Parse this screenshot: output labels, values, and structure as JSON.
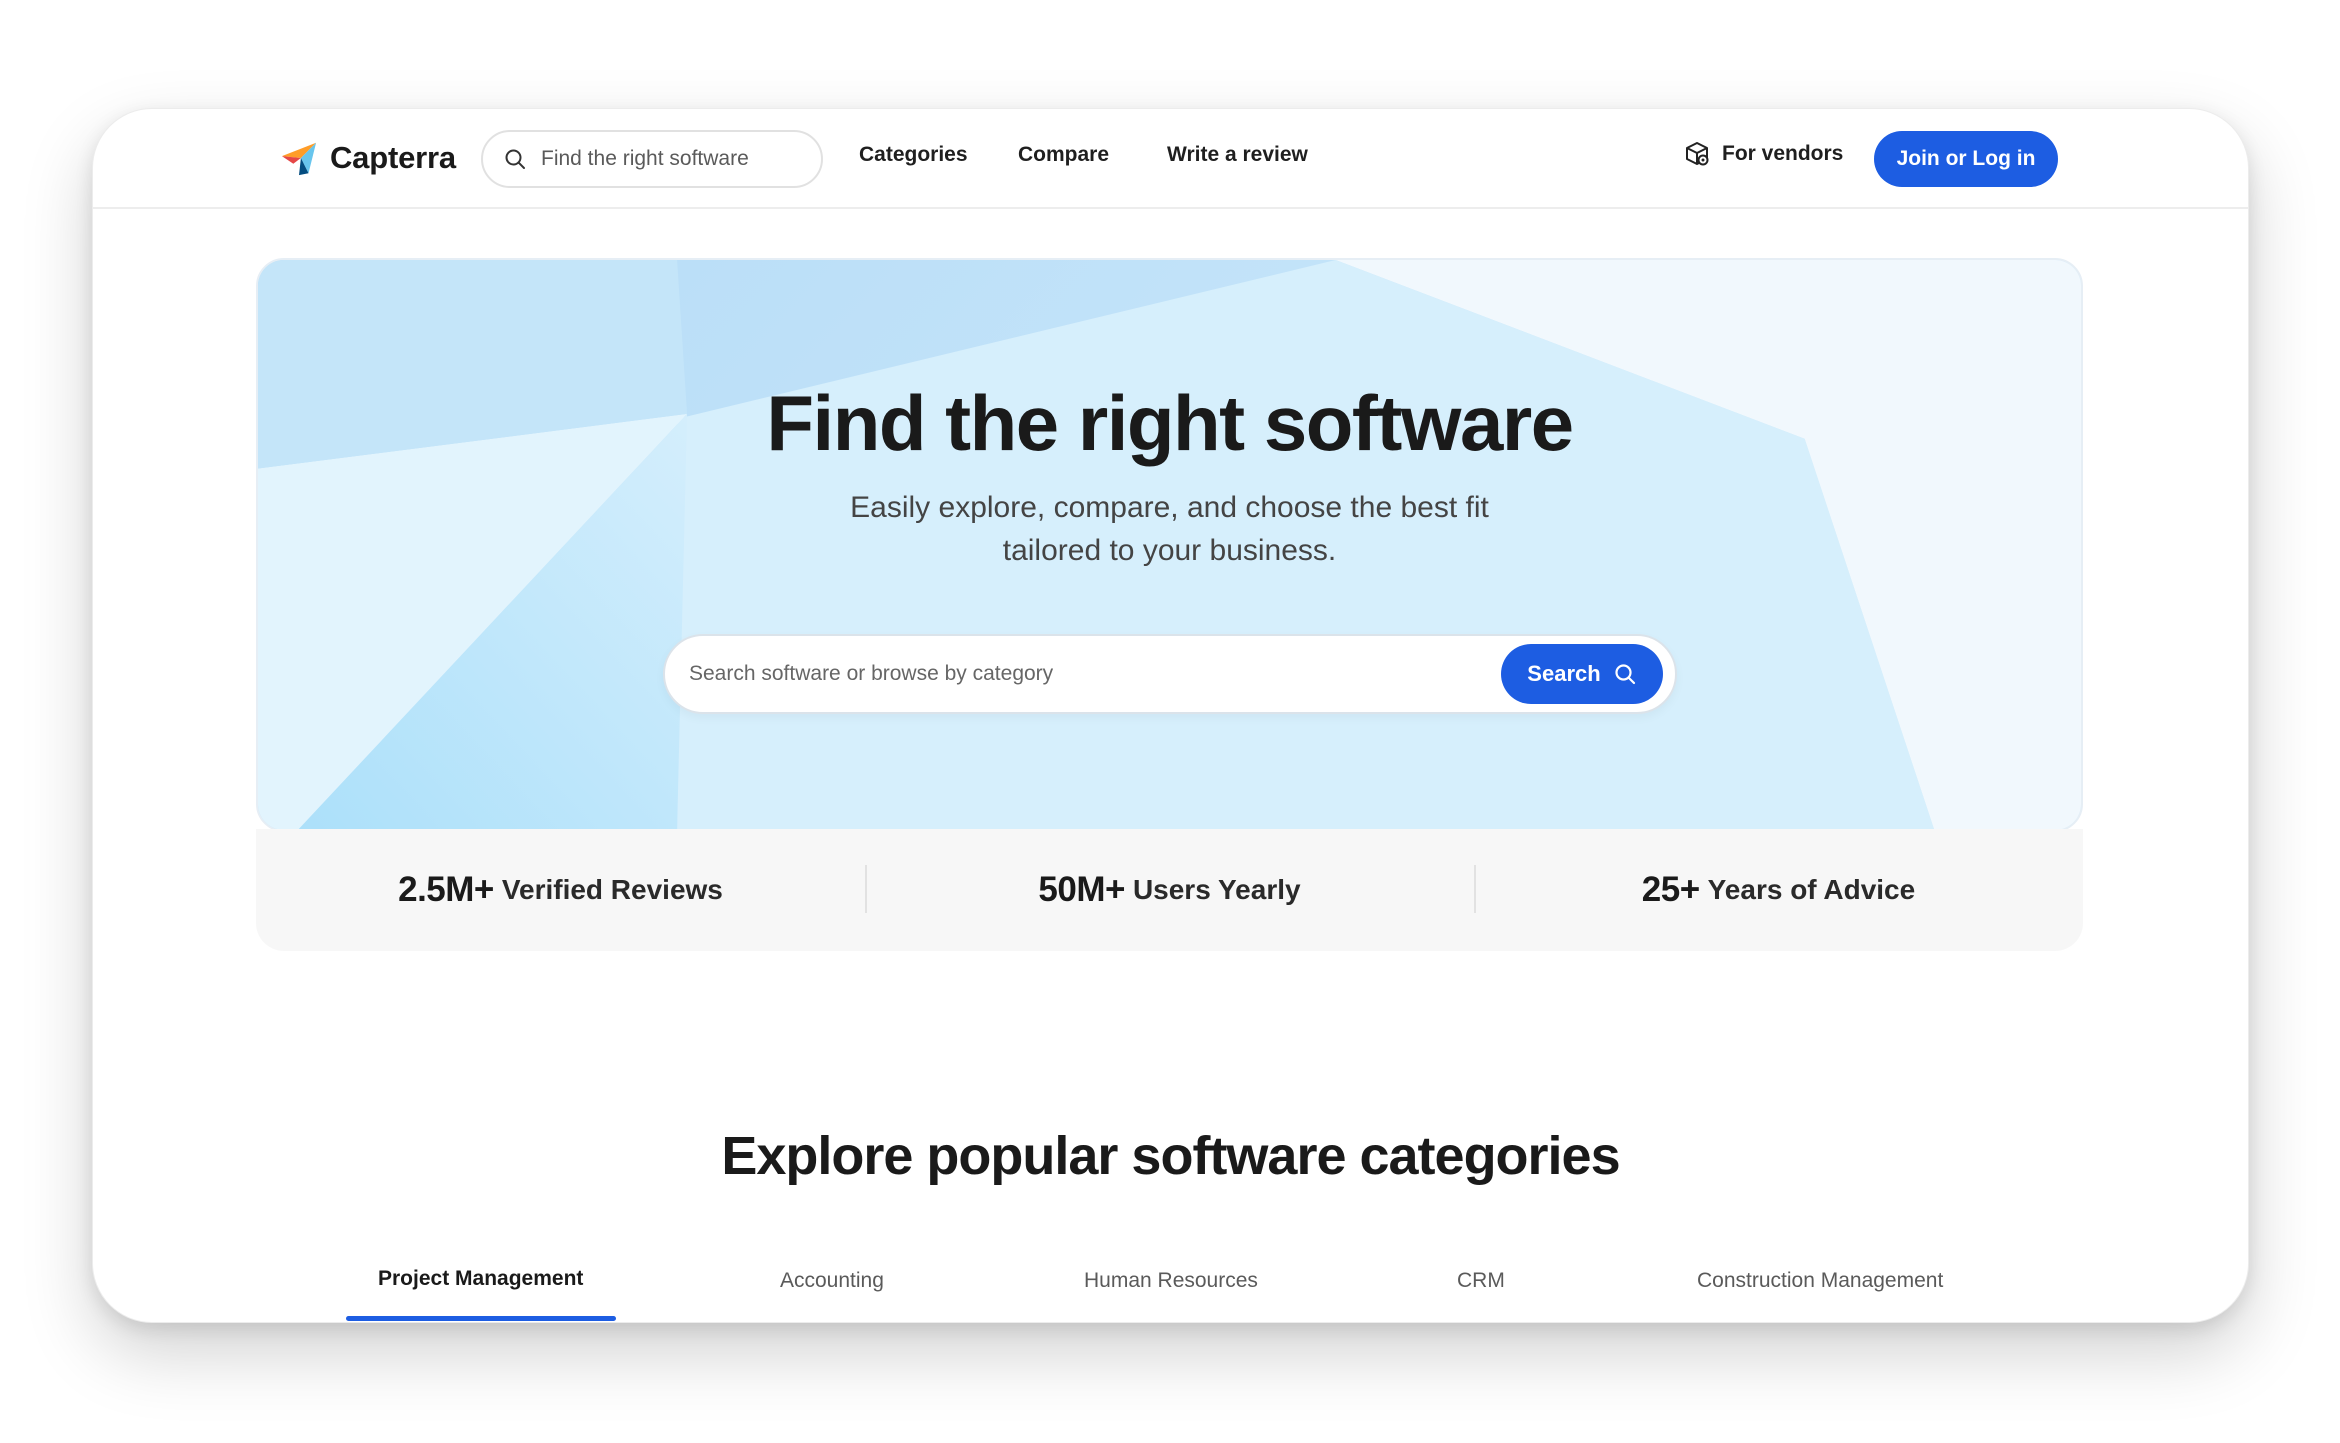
{
  "nav": {
    "logo_text": "Capterra",
    "search_placeholder": "Find the right software",
    "links": [
      "Categories",
      "Compare",
      "Write a review"
    ],
    "vendors_label": "For vendors",
    "join_label": "Join or Log in"
  },
  "hero": {
    "title": "Find the right software",
    "subtitle_line1": "Easily explore, compare, and choose the best fit",
    "subtitle_line2": "tailored to your business.",
    "search_placeholder": "Search software or browse by category",
    "search_button": "Search"
  },
  "stats": [
    {
      "number": "2.5M+",
      "label": "Verified Reviews"
    },
    {
      "number": "50M+",
      "label": "Users Yearly"
    },
    {
      "number": "25+",
      "label": "Years of Advice"
    }
  ],
  "categories": {
    "title": "Explore popular software categories",
    "tabs": [
      "Project Management",
      "Accounting",
      "Human Resources",
      "CRM",
      "Construction Management"
    ],
    "active_tab": "Project Management"
  },
  "colors": {
    "accent": "#1d5de2",
    "hero_bg": "#d3ecfb",
    "logo_orange": "#ff9d28",
    "logo_blue": "#68c5ed",
    "logo_navy": "#044d80",
    "logo_red": "#e54747"
  },
  "icons": {
    "nav_search": "search-icon",
    "vendors": "box-gear-icon",
    "hero_search": "search-icon"
  }
}
